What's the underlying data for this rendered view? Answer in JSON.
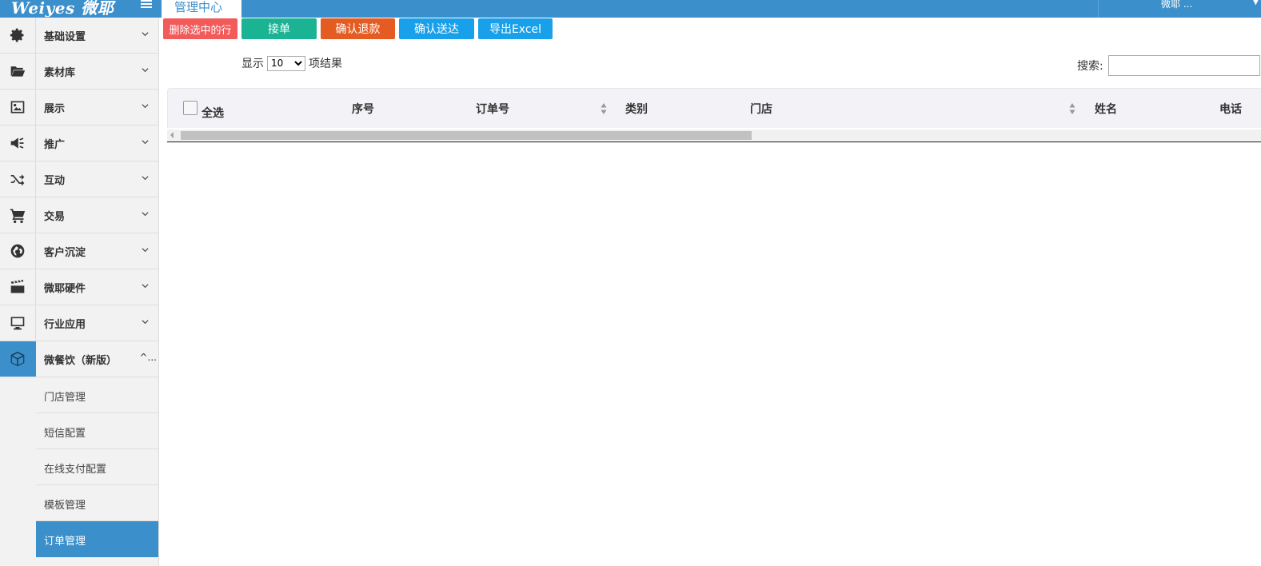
{
  "header": {
    "logo": "Weiyes 微耶",
    "active_tab": "管理中心",
    "user": "微耶 ..."
  },
  "sidebar": {
    "items": [
      {
        "label": "基础设置",
        "icon": "gear-icon"
      },
      {
        "label": "素材库",
        "icon": "folder-open-icon"
      },
      {
        "label": "展示",
        "icon": "image-icon"
      },
      {
        "label": "推广",
        "icon": "bullhorn-icon"
      },
      {
        "label": "互动",
        "icon": "shuffle-icon"
      },
      {
        "label": "交易",
        "icon": "cart-icon"
      },
      {
        "label": "客户沉淀",
        "icon": "globe-icon"
      },
      {
        "label": "微耶硬件",
        "icon": "film-clapper-icon"
      },
      {
        "label": "行业应用",
        "icon": "monitor-icon"
      },
      {
        "label": "微餐饮（新版）",
        "icon": "cube-icon",
        "open": true,
        "more": "^..."
      }
    ],
    "sub_items": [
      {
        "label": "门店管理"
      },
      {
        "label": "短信配置"
      },
      {
        "label": "在线支付配置"
      },
      {
        "label": "模板管理"
      },
      {
        "label": "订单管理",
        "active": true
      }
    ]
  },
  "toolbar": {
    "delete_label": "删除选中的行",
    "accept_label": "接单",
    "refund_label": "确认退款",
    "deliver_label": "确认送达",
    "excel_label": "导出Excel"
  },
  "table_controls": {
    "show_prefix": "显示",
    "page_size": "10",
    "show_suffix": "项结果",
    "search_label": "搜索:",
    "search_value": ""
  },
  "table": {
    "select_all": "全选",
    "columns": [
      "序号",
      "订单号",
      "类别",
      "门店",
      "姓名",
      "电话"
    ]
  },
  "colors": {
    "primary": "#3b8fca",
    "delete": "#f35a5a",
    "accept": "#1ab394",
    "refund": "#e55c23",
    "deliver": "#18a0ea"
  }
}
